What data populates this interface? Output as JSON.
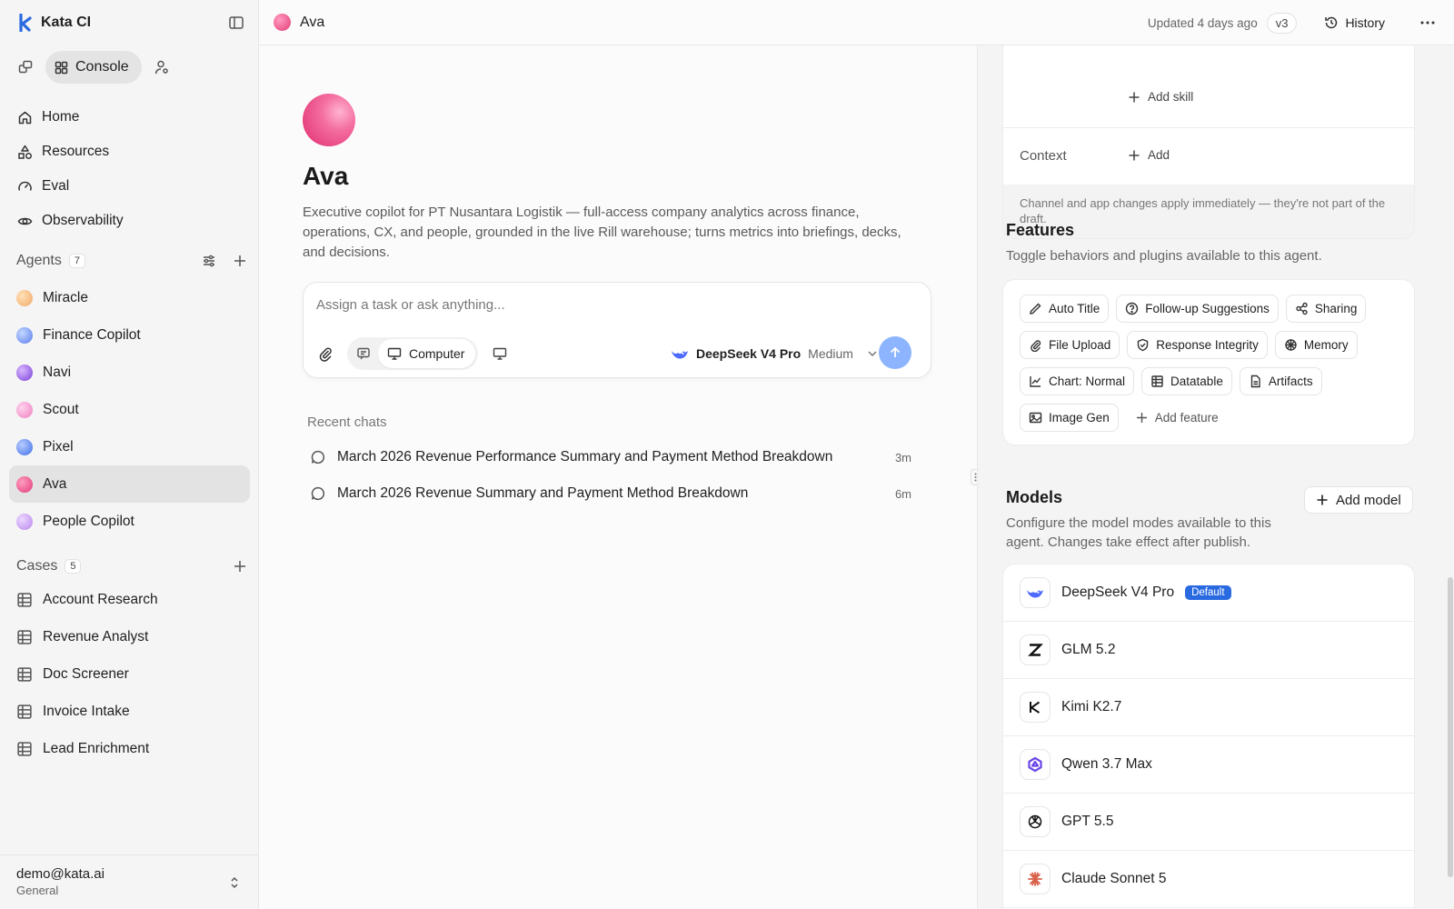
{
  "app": {
    "brand": "Kata CI",
    "console_label": "Console",
    "icons": {
      "brand": "kata-logo-icon",
      "collapse": "sidebar-toggle-icon"
    }
  },
  "nav": [
    {
      "label": "Home",
      "icon": "home-icon"
    },
    {
      "label": "Resources",
      "icon": "shapes-icon"
    },
    {
      "label": "Eval",
      "icon": "gauge-icon"
    },
    {
      "label": "Observability",
      "icon": "eye-icon"
    }
  ],
  "agents": {
    "title": "Agents",
    "count": "7",
    "items": [
      {
        "name": "Miracle",
        "color": "#f4c08a"
      },
      {
        "name": "Finance Copilot",
        "color": "#6b8cff"
      },
      {
        "name": "Navi",
        "color": "#8a4fe0"
      },
      {
        "name": "Scout",
        "color": "#f08ac8"
      },
      {
        "name": "Pixel",
        "color": "#4f7ef2"
      },
      {
        "name": "Ava",
        "color": "#e8407c",
        "active": true
      },
      {
        "name": "People Copilot",
        "color": "#c99af2"
      }
    ]
  },
  "cases": {
    "title": "Cases",
    "count": "5",
    "items": [
      "Account Research",
      "Revenue Analyst",
      "Doc Screener",
      "Invoice Intake",
      "Lead Enrichment"
    ]
  },
  "user": {
    "email": "demo@kata.ai",
    "workspace": "General"
  },
  "topbar": {
    "title": "Ava",
    "updated": "Updated 4 days ago",
    "version": "v3",
    "history_label": "History"
  },
  "agent": {
    "name": "Ava",
    "description": "Executive copilot for PT Nusantara Logistik — full-access company analytics across finance, operations, CX, and people, grounded in the live Rill warehouse; turns metrics into briefings, decks, and decisions."
  },
  "composer": {
    "placeholder": "Assign a task or ask anything...",
    "mode_label": "Computer",
    "model_name": "DeepSeek V4 Pro",
    "model_level": "Medium"
  },
  "recent": {
    "title": "Recent chats",
    "items": [
      {
        "title": "March 2026 Revenue Performance Summary and Payment Method Breakdown",
        "age": "3m"
      },
      {
        "title": "March 2026 Revenue Summary and Payment Method Breakdown",
        "age": "6m"
      }
    ]
  },
  "panel": {
    "add_skill": "Add skill",
    "context_label": "Context",
    "context_add": "Add",
    "note": "Channel and app changes apply immediately — they're not part of the draft.",
    "features": {
      "title": "Features",
      "subtitle": "Toggle behaviors and plugins available to this agent.",
      "chips": [
        {
          "label": "Auto Title",
          "icon": "pencil-icon"
        },
        {
          "label": "Follow-up Suggestions",
          "icon": "help-circle-icon"
        },
        {
          "label": "Sharing",
          "icon": "share-icon"
        },
        {
          "label": "File Upload",
          "icon": "paperclip-icon"
        },
        {
          "label": "Response Integrity",
          "icon": "shield-check-icon"
        },
        {
          "label": "Memory",
          "icon": "brain-icon"
        },
        {
          "label": "Chart: Normal",
          "icon": "line-chart-icon"
        },
        {
          "label": "Datatable",
          "icon": "table-icon"
        },
        {
          "label": "Artifacts",
          "icon": "file-icon"
        },
        {
          "label": "Image Gen",
          "icon": "image-icon"
        }
      ],
      "add_label": "Add feature"
    },
    "models": {
      "title": "Models",
      "subtitle": "Configure the model modes available to this agent. Changes take effect after publish.",
      "add_label": "Add model",
      "default_badge": "Default",
      "items": [
        {
          "name": "DeepSeek V4 Pro",
          "logo": "deepseek-logo-icon",
          "default": true
        },
        {
          "name": "GLM 5.2",
          "logo": "zhipu-logo-icon"
        },
        {
          "name": "Kimi K2.7",
          "logo": "kimi-logo-icon"
        },
        {
          "name": "Qwen 3.7 Max",
          "logo": "qwen-logo-icon"
        },
        {
          "name": "GPT 5.5",
          "logo": "openai-logo-icon"
        },
        {
          "name": "Claude Sonnet 5",
          "logo": "claude-logo-icon"
        }
      ]
    }
  }
}
